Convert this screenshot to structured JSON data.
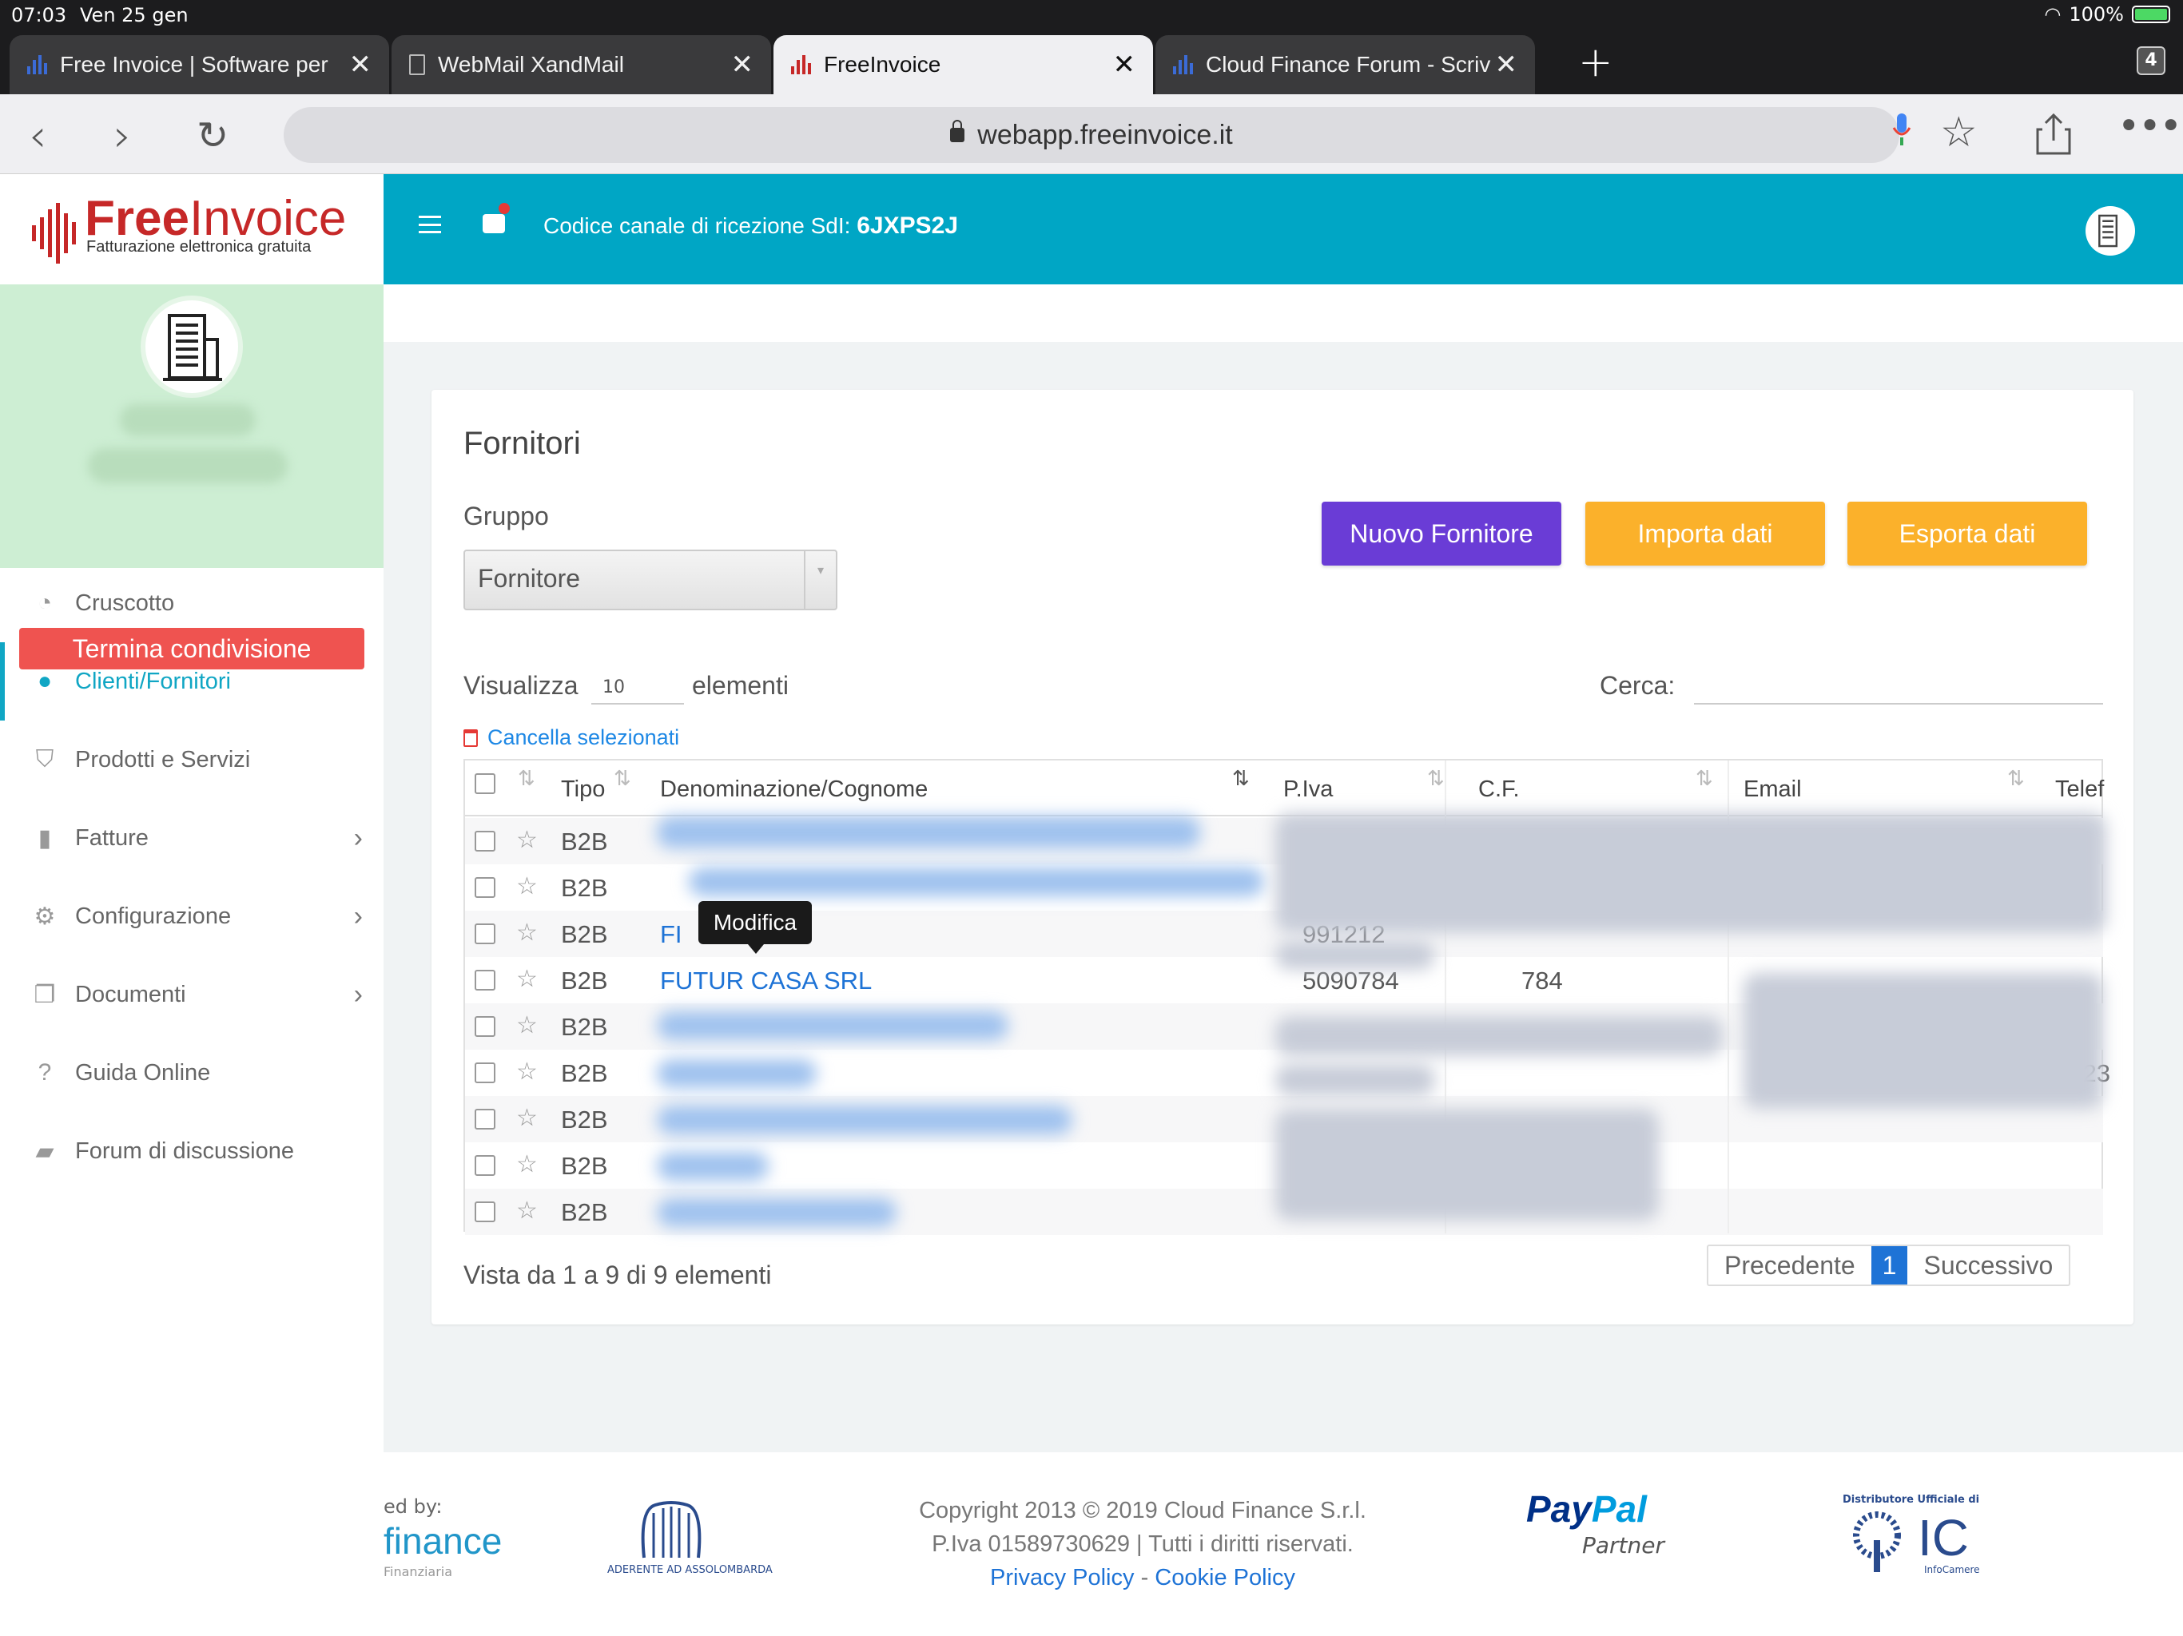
{
  "status": {
    "time": "07:03",
    "date": "Ven 25 gen",
    "battery": "100%"
  },
  "tabs": [
    {
      "title": "Free Invoice | Software per",
      "icon": "bars-icon"
    },
    {
      "title": "WebMail XandMail",
      "icon": "document-icon"
    },
    {
      "title": "FreeInvoice",
      "icon": "bars-icon",
      "active": true
    },
    {
      "title": "Cloud Finance Forum - Scriv",
      "icon": "bars-icon"
    }
  ],
  "tab_count": "4",
  "url": "webapp.freeinvoice.it",
  "brand": {
    "free": "Free",
    "invoice": "Invoice",
    "tagline": "Fatturazione elettronica gratuita"
  },
  "sidebar": {
    "termina": "Termina condivisione",
    "items": [
      {
        "label": "Cruscotto",
        "icon": "dashboard-icon"
      },
      {
        "label": "Clienti/Fornitori",
        "icon": "user-icon",
        "active": true
      },
      {
        "label": "Prodotti e Servizi",
        "icon": "basket-icon"
      },
      {
        "label": "Fatture",
        "icon": "file-icon",
        "chevron": true
      },
      {
        "label": "Configurazione",
        "icon": "gear-icon",
        "chevron": true
      },
      {
        "label": "Documenti",
        "icon": "documents-icon",
        "chevron": true
      },
      {
        "label": "Guida Online",
        "icon": "question-icon"
      },
      {
        "label": "Forum di discussione",
        "icon": "forum-icon"
      }
    ]
  },
  "header": {
    "sdi_label": "Codice canale di ricezione SdI:",
    "sdi_code": "6JXPS2J"
  },
  "page": {
    "title": "Fornitori",
    "group_label": "Gruppo",
    "group_value": "Fornitore",
    "btn_nuovo": "Nuovo Fornitore",
    "btn_importa": "Importa dati",
    "btn_esporta": "Esporta dati",
    "show_label": "Visualizza",
    "show_value": "10",
    "show_suffix": "elementi",
    "search_label": "Cerca:",
    "delete_selected": "Cancella selezionati",
    "columns": [
      "Tipo",
      "Denominazione/Cognome",
      "P.Iva",
      "C.F.",
      "Email",
      "Telef"
    ],
    "rows": [
      {
        "tipo": "B2B",
        "name": "",
        "piva": "",
        "cf": "",
        "tel": ""
      },
      {
        "tipo": "B2B",
        "name": "",
        "piva": "",
        "cf": "",
        "tel": ""
      },
      {
        "tipo": "B2B",
        "name": "FI",
        "piva": "991212",
        "cf": "",
        "tel": ""
      },
      {
        "tipo": "B2B",
        "name": "FUTUR CASA SRL",
        "piva": "5090784",
        "cf": "784",
        "tel": ""
      },
      {
        "tipo": "B2B",
        "name": "",
        "piva": "",
        "cf": "",
        "tel": ""
      },
      {
        "tipo": "B2B",
        "name": "",
        "piva": "",
        "cf": "",
        "tel": "0823"
      },
      {
        "tipo": "B2B",
        "name": "",
        "piva": "",
        "cf": "",
        "tel": ""
      },
      {
        "tipo": "B2B",
        "name": "",
        "piva": "",
        "cf": "",
        "tel": ""
      },
      {
        "tipo": "B2B",
        "name": "",
        "piva": "",
        "cf": "",
        "tel": ""
      }
    ],
    "tooltip": "Modifica",
    "info": "Vista da 1 a 9 di 9 elementi",
    "pager": {
      "prev": "Precedente",
      "current": "1",
      "next": "Successivo"
    }
  },
  "footer": {
    "powered": "ed by:",
    "finance": "finance",
    "finance_sub": "Finanziaria",
    "assolombarda": "ADERENTE AD ASSOLOMBARDA",
    "copyright_1": "Copyright 2013 © 2019 Cloud Finance S.r.l.",
    "copyright_2": "P.Iva 01589730629 | Tutti i diritti riservati.",
    "privacy": "Privacy Policy",
    "sep": " - ",
    "cookie": "Cookie Policy",
    "paypal_pay": "Pay",
    "paypal_pal": "Pal",
    "paypal_partner": "Partner",
    "ic_top": "Distributore Ufficiale di",
    "ic_letters": "IC",
    "ic_sub": "InfoCamere"
  }
}
